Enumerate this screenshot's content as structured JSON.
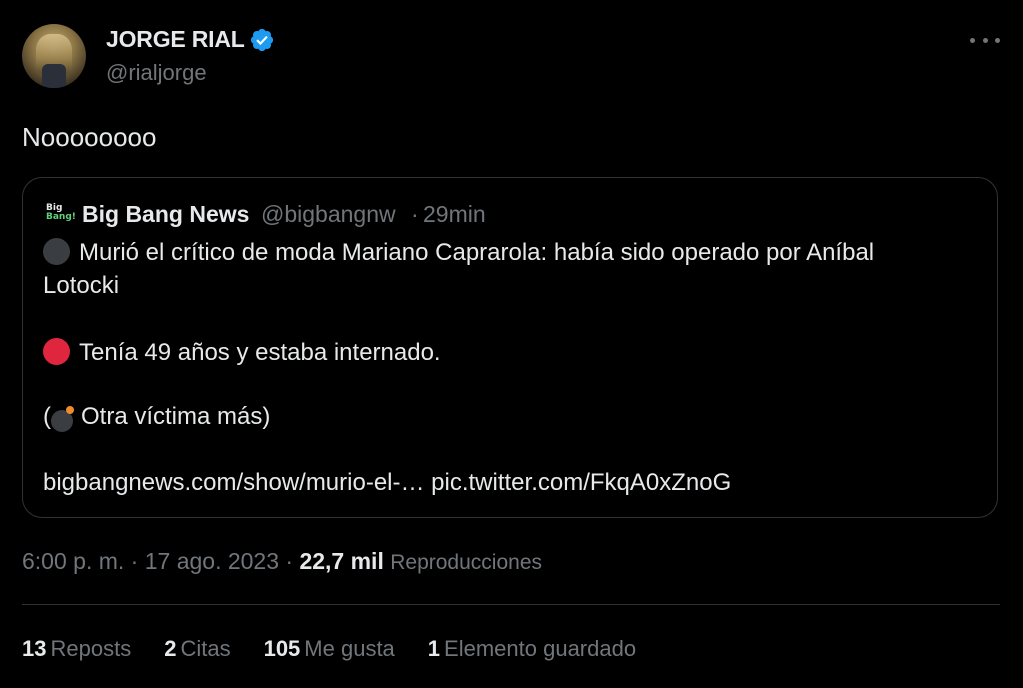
{
  "author": {
    "display_name": "JORGE RIAL",
    "handle": "@rialjorge",
    "verified_icon": "verified-badge-icon",
    "avatar_icon": "avatar"
  },
  "colors": {
    "background": "#000000",
    "text": "#e7e9ea",
    "muted": "#71767b",
    "border": "#2f3336",
    "verified": "#1d9bf0",
    "red_circle": "#e0253f",
    "black_circle": "#3a3d42"
  },
  "tweet": {
    "text": "Noooooooo"
  },
  "quoted": {
    "logo_top": "Big",
    "logo_bottom": "Bang!",
    "name": "Big Bang News",
    "handle": "@bigbangnw",
    "separator": "·",
    "time": "29min",
    "line1": "Murió el crítico de moda Mariano Caprarola: había sido operado por Aníbal",
    "line2": "Lotocki",
    "line3": "Tenía 49 años y estaba internado.",
    "line4_open": "(",
    "line4_text": "Otra víctima más)",
    "link": "bigbangnews.com/show/murio-el-… pic.twitter.com/FkqA0xZnoG"
  },
  "meta": {
    "timestamp": "6:00 p. m. · 17 ago. 2023 · ",
    "views_count": "22,7 mil",
    "views_label": "Reproducciones"
  },
  "stats": [
    {
      "num": "13",
      "label": "Reposts"
    },
    {
      "num": "2",
      "label": "Citas"
    },
    {
      "num": "105",
      "label": "Me gusta"
    },
    {
      "num": "1",
      "label": "Elemento guardado"
    }
  ]
}
